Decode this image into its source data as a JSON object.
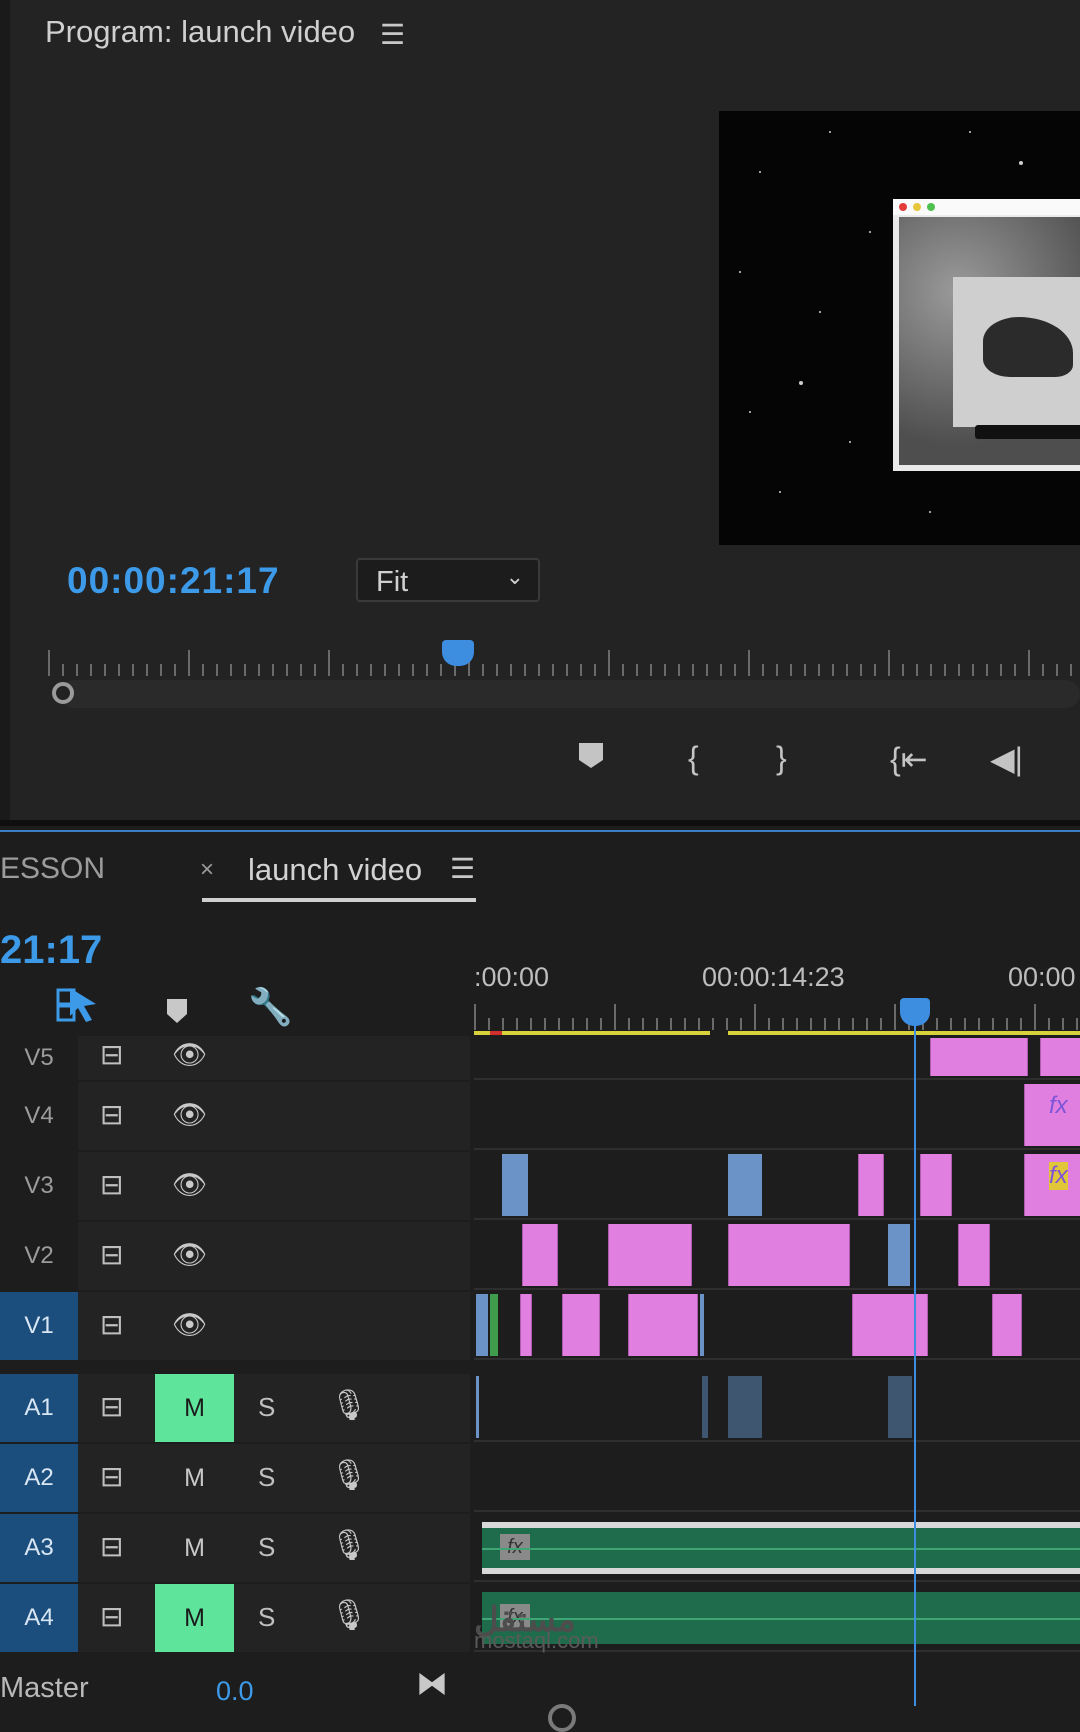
{
  "program": {
    "title": "Program: launch video",
    "menu_icon": "hamburger-menu-icon",
    "timecode": "00:00:21:17",
    "zoom": "Fit",
    "transport_icons": [
      "marker-icon",
      "mark-in-icon",
      "mark-out-icon",
      "go-to-in-icon",
      "step-back-icon"
    ]
  },
  "timeline": {
    "tabs": [
      {
        "label": "ESSON"
      },
      {
        "label": "launch video"
      }
    ],
    "close_glyph": "×",
    "timecode": "21:17",
    "ruler_labels": [
      ":00:00",
      "00:00:14:23",
      "00:00"
    ],
    "tools": [
      "linked-selection-icon",
      "add-marker-icon",
      "settings-wrench-icon"
    ],
    "video_tracks": [
      {
        "name": "V5",
        "active": false
      },
      {
        "name": "V4",
        "active": false
      },
      {
        "name": "V3",
        "active": false
      },
      {
        "name": "V2",
        "active": false
      },
      {
        "name": "V1",
        "active": true
      }
    ],
    "audio_tracks": [
      {
        "name": "A1",
        "mute": "M",
        "solo": "S",
        "muted": true
      },
      {
        "name": "A2",
        "mute": "M",
        "solo": "S",
        "muted": false
      },
      {
        "name": "A3",
        "mute": "M",
        "solo": "S",
        "muted": false
      },
      {
        "name": "A4",
        "mute": "M",
        "solo": "S",
        "muted": true
      }
    ],
    "fx_label": "fx",
    "master_label": "Master",
    "master_value": "0.0"
  },
  "watermark": {
    "arabic": "مستقل",
    "latin": "mostaql.com"
  },
  "colors": {
    "accent": "#3d9ae8",
    "clip_pink": "#e07fe0",
    "clip_blue": "#6b93c7",
    "audio_green": "#1e6c4b",
    "mute_on": "#5fe49c",
    "work_area": "#d8d33a"
  }
}
